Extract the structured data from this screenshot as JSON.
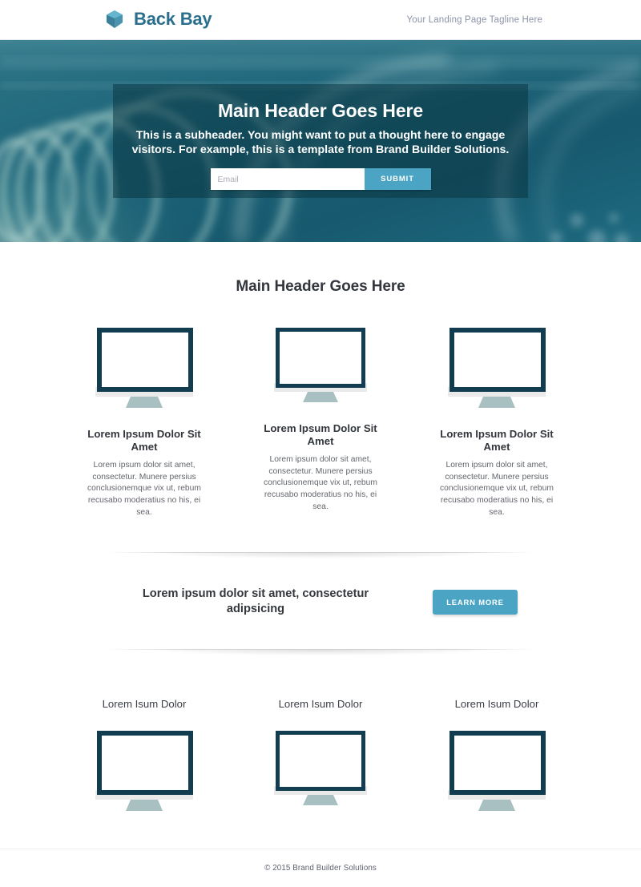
{
  "header": {
    "brand_name": "Back Bay",
    "logo_icon": "hexagon-gem-icon",
    "tagline": "Your Landing Page Tagline Here"
  },
  "hero": {
    "title": "Main Header Goes Here",
    "subheader": "This is a subheader. You might want to put a thought here to engage visitors. For example, this is a template from Brand Builder Solutions.",
    "email_placeholder": "Email",
    "email_value": "",
    "submit_label": "SUBMIT",
    "overlay_color": "#0a3440",
    "background_color": "#1b6074"
  },
  "features": {
    "section_title": "Main Header Goes Here",
    "items": [
      {
        "icon": "desktop-monitor-icon",
        "title": "Lorem Ipsum Dolor Sit Amet",
        "body": "Lorem ipsum dolor sit amet, consectetur. Munere persius conclusionemque vix ut, rebum recusabo moderatius no his, ei sea."
      },
      {
        "icon": "desktop-monitor-icon",
        "title": "Lorem Ipsum Dolor Sit Amet",
        "body": "Lorem ipsum dolor sit amet, consectetur. Munere persius conclusionemque vix ut, rebum recusabo moderatius no his, ei sea."
      },
      {
        "icon": "desktop-monitor-icon",
        "title": "Lorem Ipsum Dolor Sit Amet",
        "body": "Lorem ipsum dolor sit amet, consectetur. Munere persius conclusionemque vix ut, rebum recusabo moderatius no his, ei sea."
      }
    ]
  },
  "cta": {
    "text": "Lorem ipsum dolor sit amet, consectetur adipsicing",
    "button_label": "LEARN MORE",
    "button_color": "#4ba4c4"
  },
  "showcase": {
    "items": [
      {
        "title": "Lorem Isum Dolor",
        "icon": "desktop-monitor-icon"
      },
      {
        "title": "Lorem Isum Dolor",
        "icon": "desktop-monitor-icon"
      },
      {
        "title": "Lorem Isum Dolor",
        "icon": "desktop-monitor-icon"
      }
    ]
  },
  "footer": {
    "copyright": "© 2015 Brand Builder Solutions"
  },
  "theme": {
    "accent": "#4ba4c4",
    "brand_text": "#2b6f8e",
    "monitor_bezel": "#123d50",
    "monitor_stand": "#a9c0c2",
    "monitor_shelf": "#eaeaea",
    "heading": "#33373d",
    "body_text": "#62666d"
  }
}
